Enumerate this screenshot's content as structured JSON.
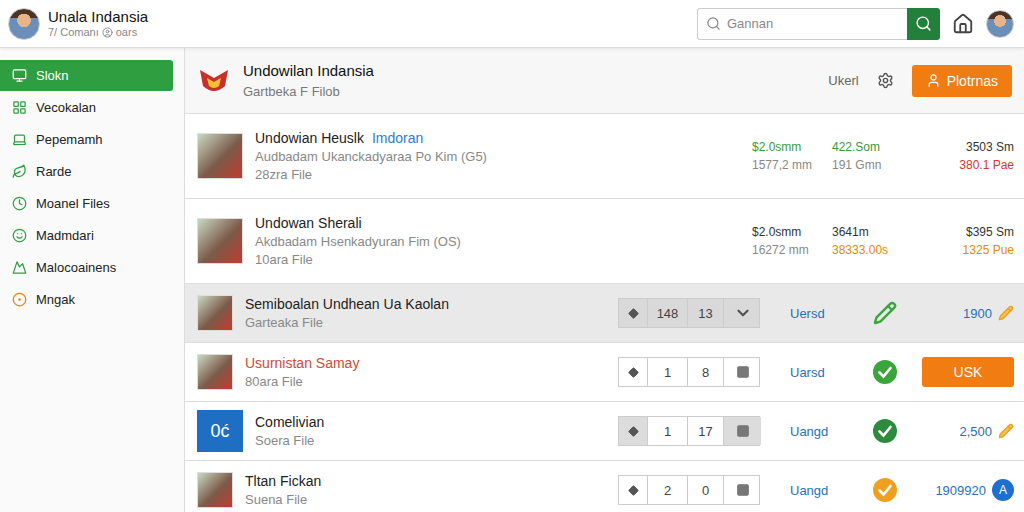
{
  "header": {
    "title": "Unala Indansia",
    "subtitle": "7/ Comanı",
    "subtitle_extra": "oars",
    "search": {
      "placeholder": "Gannan"
    }
  },
  "sidebar": {
    "items": [
      {
        "label": "Slokn",
        "selected": true
      },
      {
        "label": "Vecokalan",
        "selected": false
      },
      {
        "label": "Pepemamh",
        "selected": false
      },
      {
        "label": "Rarde",
        "selected": false
      },
      {
        "label": "Moanel Files",
        "selected": false
      },
      {
        "label": "Madmdari",
        "selected": false
      },
      {
        "label": "Malocoainens",
        "selected": false
      },
      {
        "label": "Mngak",
        "selected": false
      }
    ]
  },
  "page": {
    "title": "Undowilan Indansia",
    "subtitle": "Gartbeka F Filob",
    "link": "Ukerl",
    "button": "Plotrnas"
  },
  "file_rows": [
    {
      "name": "Undowian Heuslk",
      "tag": "Imdoran",
      "description": "Audbadam Ukanckadyaraa Po Kim (G5)",
      "meta": "28zra File",
      "stats": [
        {
          "value": "$2.0smm",
          "sub": "1577,2 mm",
          "value_color": "#3a9a3a",
          "sub_color": "#888888"
        },
        {
          "value": "422.Som",
          "sub": "191 Gmn",
          "value_color": "#3a9a3a",
          "sub_color": "#888888"
        },
        {
          "value": "3503 Sm",
          "sub": "380.1 Pae",
          "value_color": "#333333",
          "sub_color": "#d9342b"
        }
      ]
    },
    {
      "name": "Undowan Sherali",
      "tag": "",
      "description": "Akdbadam Hsenkadyuran Fim (OS)",
      "meta": "10ara File",
      "stats": [
        {
          "value": "$2.0smm",
          "sub": "16272 mm",
          "value_color": "#333333",
          "sub_color": "#888888"
        },
        {
          "value": "3641m",
          "sub": "38333.00s",
          "value_color": "#333333",
          "sub_color": "#e68a00"
        },
        {
          "value": "$395 Sm",
          "sub": "1325 Pue",
          "value_color": "#333333",
          "sub_color": "#e68a00"
        }
      ]
    }
  ],
  "list_rows": [
    {
      "name": "Semiboalan Undhean Ua Kaolan",
      "meta": "Garteaka File",
      "name_color": "#222222",
      "selected": true,
      "thumb": "photo",
      "logo_text": "",
      "stepper": [
        "148",
        "13"
      ],
      "stepper_end": "arrow",
      "status": "Uersd",
      "status_kind": "pen",
      "status_color": "#3aa53a",
      "value": "1900",
      "value_kind": "edit",
      "badge": ""
    },
    {
      "name": "Usurnistan Samay",
      "meta": "80ara File",
      "name_color": "#d04a3a",
      "selected": false,
      "thumb": "photo",
      "logo_text": "",
      "stepper": [
        "1",
        "8"
      ],
      "stepper_end": "square",
      "status": "Uarsd",
      "status_kind": "check",
      "status_color": "#3aa53a",
      "value": "USK",
      "value_kind": "button",
      "badge": ""
    },
    {
      "name": "Comelivian",
      "meta": "Soera File",
      "name_color": "#222222",
      "selected": false,
      "thumb": "logo",
      "logo_text": "0ć",
      "stepper": [
        "1",
        "17"
      ],
      "stepper_end": "square",
      "status": "Uangd",
      "status_kind": "check",
      "status_color": "#2e8b3e",
      "value": "2,500",
      "value_kind": "edit",
      "badge": ""
    },
    {
      "name": "Tltan Fickan",
      "meta": "Suena File",
      "name_color": "#222222",
      "selected": false,
      "thumb": "photo",
      "logo_text": "",
      "stepper": [
        "2",
        "0"
      ],
      "stepper_end": "square",
      "status": "Uangd",
      "status_kind": "check",
      "status_color": "#f0a020",
      "value": "1909920",
      "value_kind": "badge",
      "badge": "A"
    }
  ]
}
